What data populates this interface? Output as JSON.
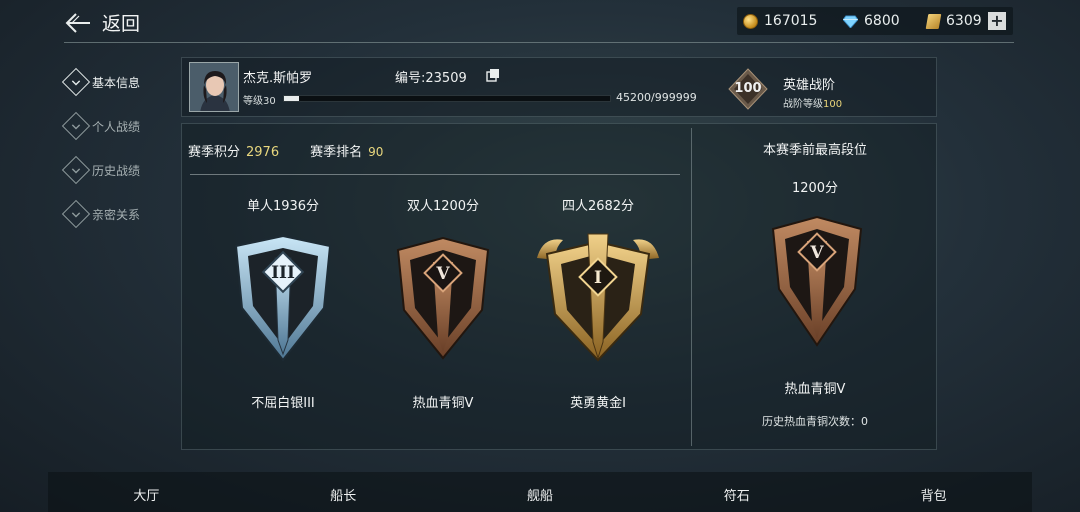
{
  "header": {
    "back_label": "返回",
    "currencies": [
      {
        "icon": "coin-icon",
        "value": "167015"
      },
      {
        "icon": "diamond-icon",
        "value": "6800"
      },
      {
        "icon": "ticket-icon",
        "value": "6309"
      }
    ],
    "add_label": "+"
  },
  "sidebar": {
    "items": [
      {
        "label": "基本信息",
        "active": true
      },
      {
        "label": "个人战绩",
        "active": false
      },
      {
        "label": "历史战绩",
        "active": false
      },
      {
        "label": "亲密关系",
        "active": false
      }
    ]
  },
  "profile": {
    "name": "杰克.斯帕罗",
    "id_text": "编号:23509",
    "level_text": "等级30",
    "xp_text": "45200/999999",
    "xp_progress": 0.045,
    "rank_badge": "100",
    "rank_title": "英雄战阶",
    "rank_level_label": "战阶等级",
    "rank_level_value": "100"
  },
  "season": {
    "score_label": "赛季积分",
    "score_value": "2976",
    "rank_label": "赛季排名",
    "rank_value": "90",
    "modes": [
      {
        "title": "单人1936分",
        "tier": "不屈白银III",
        "numeral": "III",
        "style": "silver"
      },
      {
        "title": "双人1200分",
        "tier": "热血青铜V",
        "numeral": "V",
        "style": "bronze"
      },
      {
        "title": "四人2682分",
        "tier": "英勇黄金I",
        "numeral": "I",
        "style": "gold"
      }
    ],
    "best": {
      "title": "本赛季前最高段位",
      "score": "1200分",
      "numeral": "V",
      "tier": "热血青铜V",
      "history": "历史热血青铜次数：0"
    }
  },
  "bottom_tabs": [
    "大厅",
    "船长",
    "舰船",
    "符石",
    "背包"
  ],
  "colors": {
    "accent_gold": "#e8d77e",
    "silver": "#8fb6d3",
    "bronze": "#9a6a46",
    "gold": "#c9a14a"
  }
}
